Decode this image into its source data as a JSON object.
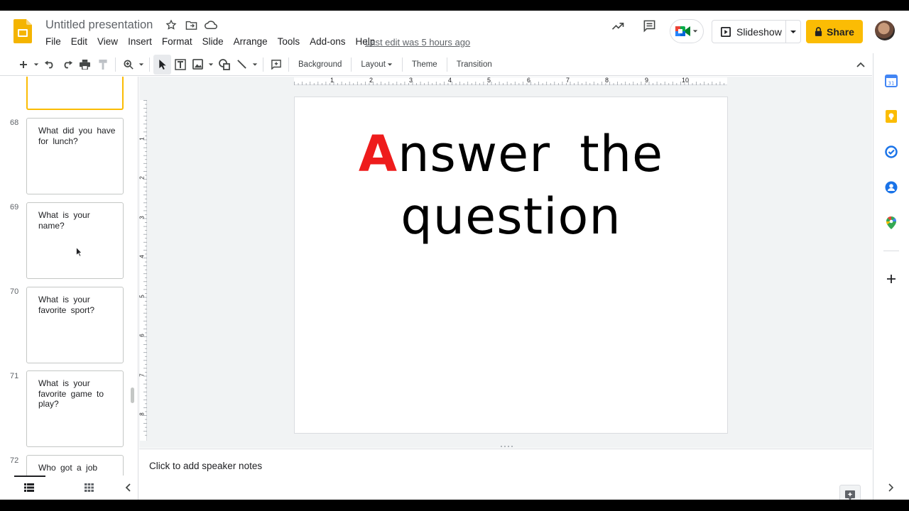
{
  "header": {
    "title": "Untitled presentation",
    "menu": [
      "File",
      "Edit",
      "View",
      "Insert",
      "Format",
      "Slide",
      "Arrange",
      "Tools",
      "Add-ons",
      "Help"
    ],
    "last_edit": "Last edit was 5 hours ago",
    "slideshow_label": "Slideshow",
    "share_label": "Share"
  },
  "toolbar": {
    "background_label": "Background",
    "layout_label": "Layout",
    "theme_label": "Theme",
    "transition_label": "Transition"
  },
  "filmstrip": {
    "slides": [
      {
        "number": "68",
        "text": "What did you have for lunch?"
      },
      {
        "number": "69",
        "text": "What is your name?"
      },
      {
        "number": "70",
        "text": "What is your favorite sport?"
      },
      {
        "number": "71",
        "text": "What is your favorite game to play?"
      },
      {
        "number": "72",
        "text": "Who got a job"
      }
    ]
  },
  "rulers": {
    "horizontal": [
      "1",
      "2",
      "3",
      "4",
      "5",
      "6",
      "7",
      "8",
      "9",
      "10"
    ],
    "vertical": [
      "1",
      "2",
      "3",
      "4",
      "5",
      "6",
      "7",
      "8"
    ]
  },
  "slide": {
    "title_first_letter": "A",
    "title_rest_line1": "nswer the",
    "title_line2": "question",
    "accent_color": "#ee1c1c"
  },
  "notes": {
    "placeholder": "Click to add speaker notes"
  },
  "side_panel": {
    "icons": [
      "calendar-icon",
      "keep-icon",
      "tasks-icon",
      "contacts-icon",
      "maps-icon",
      "add-icon"
    ]
  }
}
